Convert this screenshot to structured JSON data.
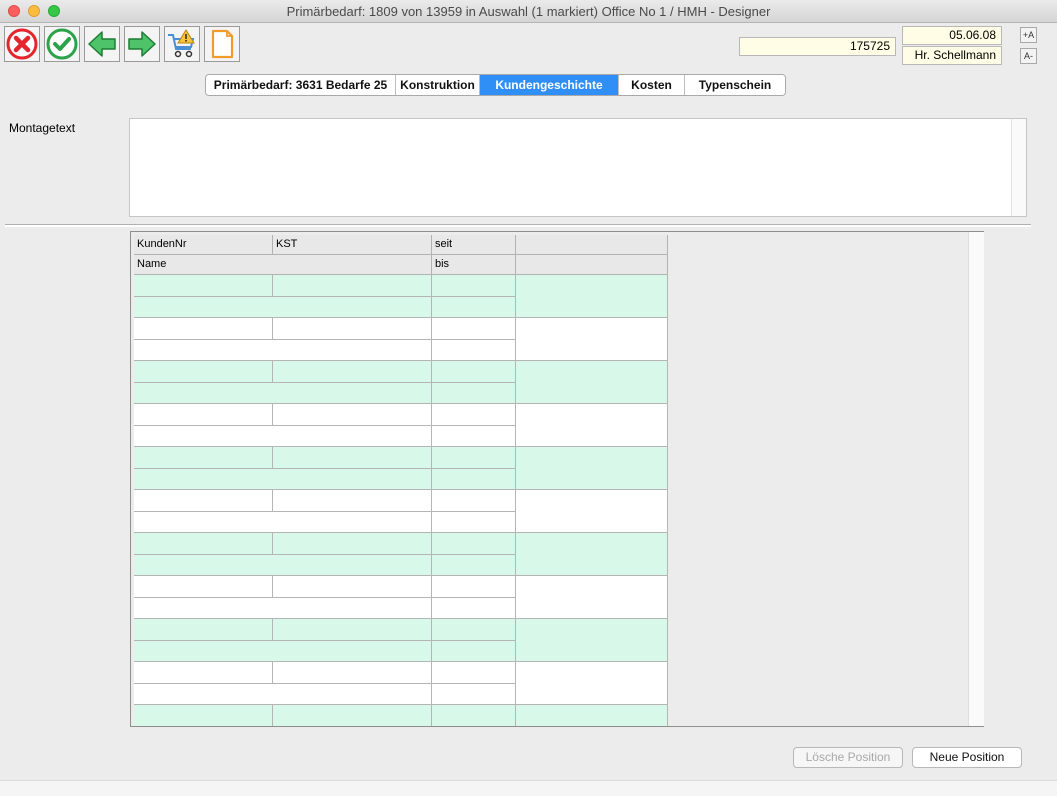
{
  "window": {
    "title": "Primärbedarf: 1809 von 13959 in Auswahl  (1 markiert) Office No 1 /  HMH - Designer"
  },
  "toolbar": {
    "buttons": [
      {
        "name": "cancel",
        "icon": "cancel-x-icon",
        "color": "#e3262e"
      },
      {
        "name": "ok",
        "icon": "checkmark-icon",
        "color": "#2ca34a"
      },
      {
        "name": "back",
        "icon": "arrow-left-icon",
        "color": "#2ca34a"
      },
      {
        "name": "forward",
        "icon": "arrow-right-icon",
        "color": "#2ca34a"
      },
      {
        "name": "cart-warning",
        "icon": "cart-warning-icon",
        "color": "#4a8fd6"
      },
      {
        "name": "document",
        "icon": "document-icon",
        "color": "#f39a2c"
      }
    ],
    "order_number": "175725",
    "date": "05.06.08",
    "user": "Hr. Schellmann",
    "font_increase_label": "+A",
    "font_decrease_label": "A-"
  },
  "tabs": [
    {
      "label": "Primärbedarf: 3631 Bedarfe 25",
      "active": false
    },
    {
      "label": "Konstruktion",
      "active": false
    },
    {
      "label": "Kundengeschichte",
      "active": true
    },
    {
      "label": "Kosten",
      "active": false
    },
    {
      "label": "Typenschein",
      "active": false
    }
  ],
  "montage": {
    "label": "Montagetext",
    "value": ""
  },
  "grid": {
    "headers": {
      "kundennr": "KundenNr",
      "kst": "KST",
      "seit": "seit",
      "name": "Name",
      "bis": "bis"
    },
    "row_colors": {
      "green": "#d8f8ea",
      "white": "#ffffff"
    }
  },
  "footer": {
    "delete_label": "Lösche Position",
    "new_label": "Neue Position"
  }
}
